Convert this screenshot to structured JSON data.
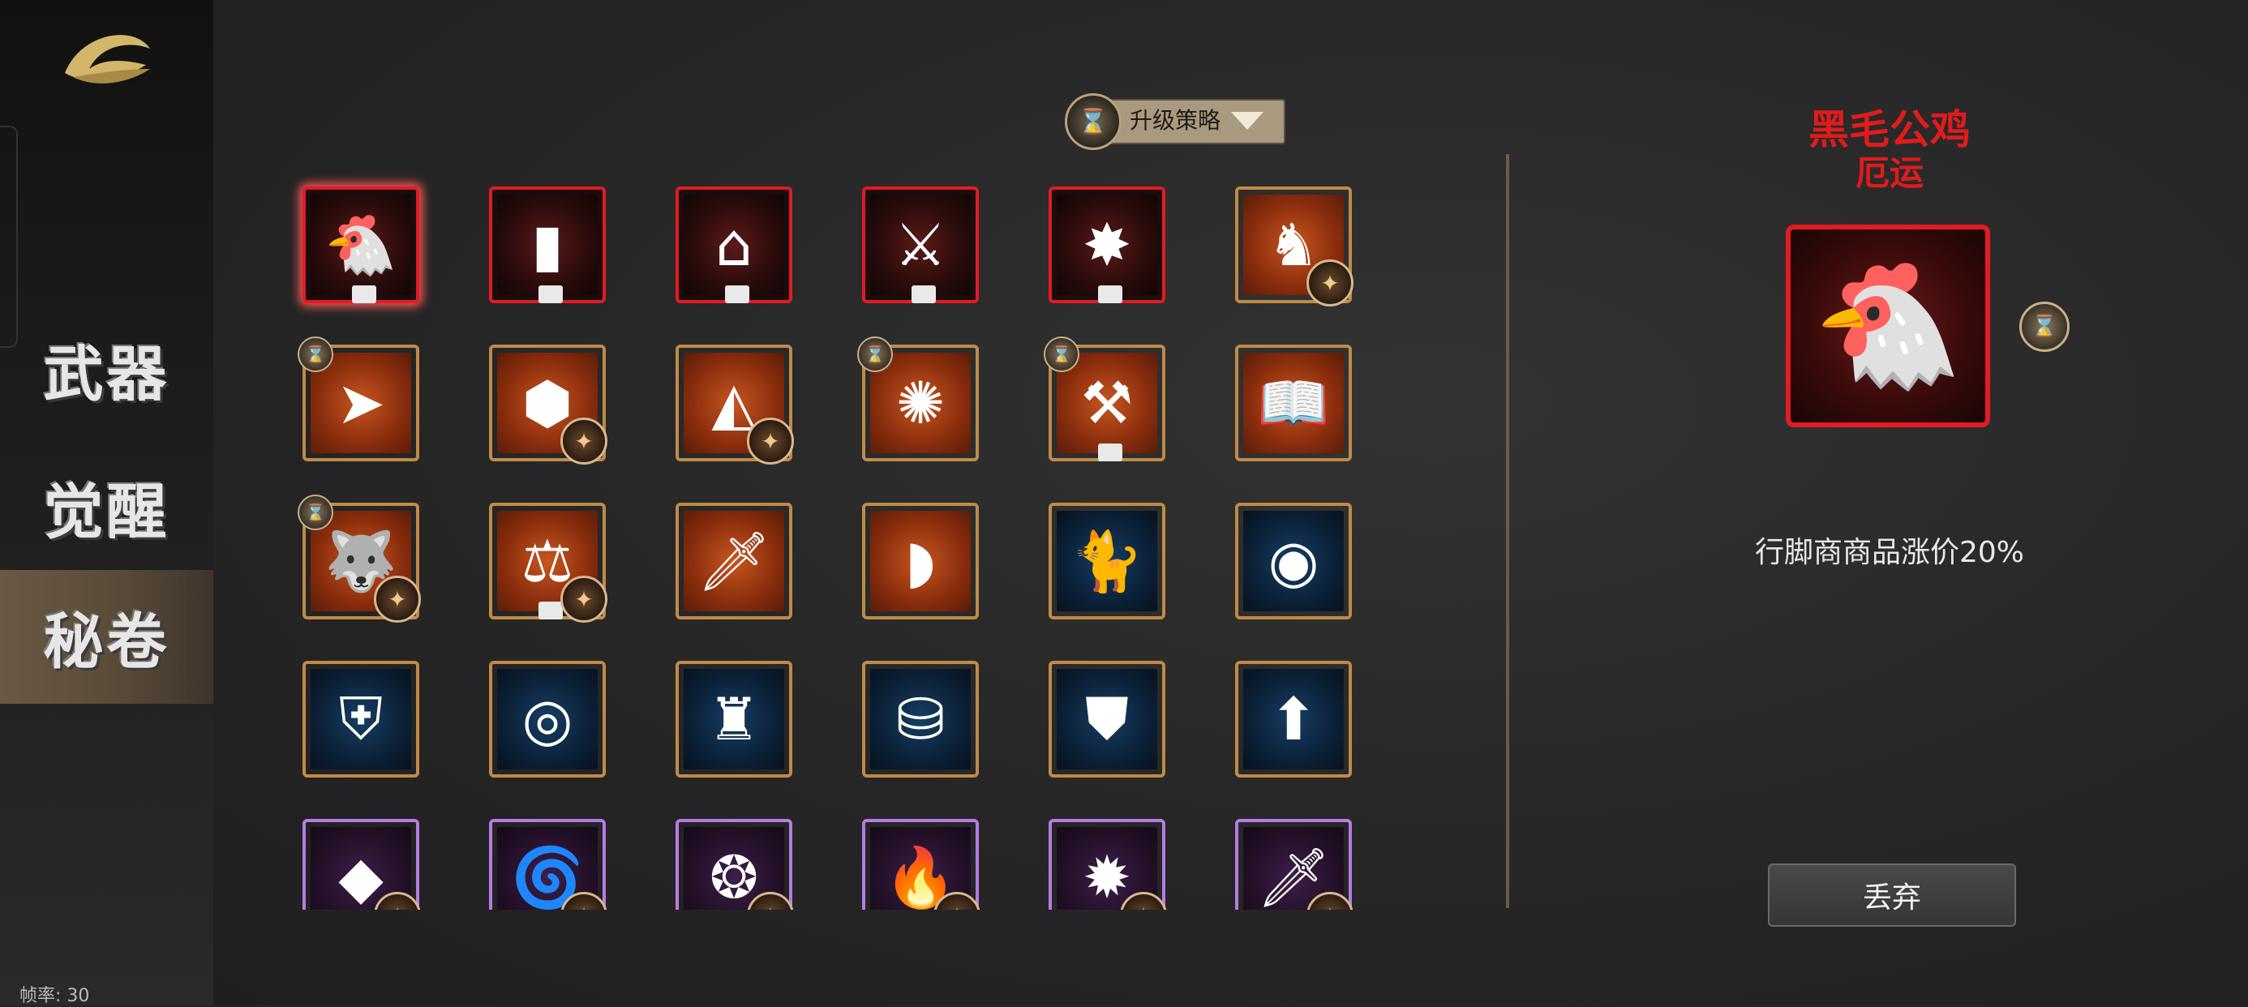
{
  "sidebar": {
    "items": [
      {
        "label": "武器"
      },
      {
        "label": "觉醒"
      },
      {
        "label": "秘卷"
      }
    ],
    "active_index": 2,
    "fps_label": "帧率: 30"
  },
  "toolbar": {
    "strategy_label": "升级策略"
  },
  "grid": {
    "tiles": [
      {
        "icon": "rooster-icon",
        "glyph": "🐔",
        "rarity": "red",
        "selected": true,
        "locked": true,
        "badge": false,
        "upgradable": false
      },
      {
        "icon": "paper-bag-icon",
        "glyph": "▮",
        "rarity": "red",
        "locked": true
      },
      {
        "icon": "slipper-icon",
        "glyph": "⌂",
        "rarity": "red",
        "locked": true
      },
      {
        "icon": "broken-sword-icon",
        "glyph": "⚔",
        "rarity": "red",
        "locked": true
      },
      {
        "icon": "crushed-coin-icon",
        "glyph": "✸",
        "rarity": "red",
        "locked": true
      },
      {
        "icon": "blue-sock-icon",
        "glyph": "♞",
        "rarity": "gold",
        "badge": true
      },
      {
        "icon": "arrowhead-icon",
        "glyph": "➤",
        "rarity": "gold",
        "upgradable": true
      },
      {
        "icon": "gold-nut-icon",
        "glyph": "⬢",
        "rarity": "gold",
        "badge": true
      },
      {
        "icon": "crystal-blade-icon",
        "glyph": "◭",
        "rarity": "gold",
        "badge": true
      },
      {
        "icon": "gold-coins-icon",
        "glyph": "✺",
        "rarity": "gold",
        "upgradable": true
      },
      {
        "icon": "anvil-hammer-icon",
        "glyph": "⚒",
        "rarity": "gold",
        "upgradable": true,
        "locked": true
      },
      {
        "icon": "spellbook-icon",
        "glyph": "📖",
        "rarity": "gold"
      },
      {
        "icon": "wolf-icon",
        "glyph": "🐺",
        "rarity": "gold",
        "upgradable": true,
        "badge": true
      },
      {
        "icon": "scales-icon",
        "glyph": "⚖",
        "rarity": "gold",
        "locked": true,
        "badge": true
      },
      {
        "icon": "red-sword-icon",
        "glyph": "🗡",
        "rarity": "gold"
      },
      {
        "icon": "rock-head-icon",
        "glyph": "◗",
        "rarity": "gold"
      },
      {
        "icon": "blue-cat-icon",
        "glyph": "🐈",
        "rarity": "gold"
      },
      {
        "icon": "red-orb-icon",
        "glyph": "◉",
        "rarity": "gold"
      },
      {
        "icon": "blue-shield-icon",
        "glyph": "⛨",
        "rarity": "gold"
      },
      {
        "icon": "blue-spiral-icon",
        "glyph": "◎",
        "rarity": "gold"
      },
      {
        "icon": "blue-cup-icon",
        "glyph": "♜",
        "rarity": "gold"
      },
      {
        "icon": "coin-stack-icon",
        "glyph": "⛁",
        "rarity": "gold"
      },
      {
        "icon": "blue-armor-icon",
        "glyph": "⛊",
        "rarity": "gold"
      },
      {
        "icon": "arrow-up-icon",
        "glyph": "⬆",
        "rarity": "gold"
      },
      {
        "icon": "red-crystal-icon",
        "glyph": "◆",
        "rarity": "purple",
        "badge": true
      },
      {
        "icon": "fire-ring-icon",
        "glyph": "🌀",
        "rarity": "purple",
        "badge": true
      },
      {
        "icon": "green-slime-icon",
        "glyph": "❂",
        "rarity": "purple",
        "badge": true
      },
      {
        "icon": "flame-icon",
        "glyph": "🔥",
        "rarity": "purple",
        "badge": true
      },
      {
        "icon": "explosion-icon",
        "glyph": "✹",
        "rarity": "purple",
        "badge": true
      },
      {
        "icon": "dagger-icon",
        "glyph": "🗡",
        "rarity": "purple",
        "badge": true
      }
    ]
  },
  "detail": {
    "name": "黑毛公鸡",
    "subtitle": "厄运",
    "icon": "rooster-icon",
    "glyph": "🐔",
    "description": "行脚商商品涨价20%",
    "discard_label": "丢弃"
  },
  "colors": {
    "red_rarity": "#e31b23",
    "gold_rarity": "#c08a46",
    "purple_rarity": "#b87ae6",
    "title_red": "#e01b1b",
    "active_tab": "#5e4f3c"
  }
}
